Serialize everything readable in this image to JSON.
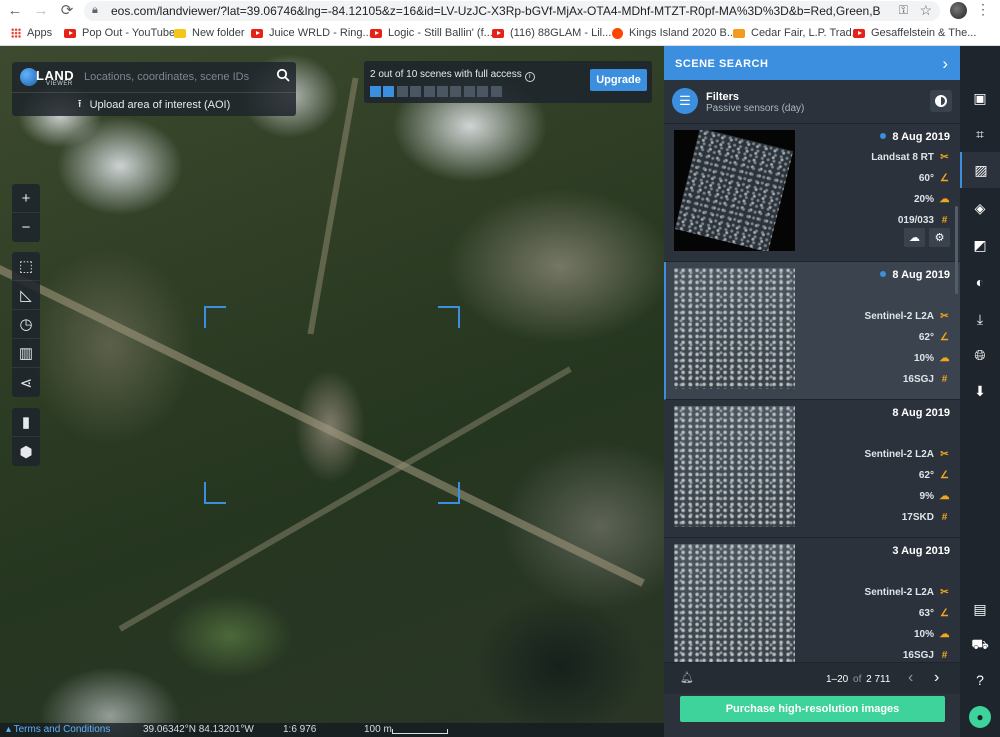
{
  "browser": {
    "url": "eos.com/landviewer/?lat=39.06746&lng=-84.12105&z=16&id=LV-UzJC-X3Rp-bGVf-MjAx-OTA4-MDhf-MTZT-R0pf-MA%3D%3D&b=Red,Green,Blue&anti",
    "bookmarks": [
      "Apps",
      "Pop Out - YouTube",
      "New folder",
      "Juice WRLD - Ring...",
      "Logic - Still Ballin' (f...",
      "(116) 88GLAM - Lil...",
      "Kings Island 2020 B...",
      "Cedar Fair, L.P. Trad...",
      "Gesaffelstein & The..."
    ]
  },
  "map": {
    "logo_text": "LAND",
    "logo_sub": "VIEWER",
    "search_placeholder": "Locations, coordinates, scene IDs",
    "upload_label": "Upload area of interest (AOI)",
    "access_text": "2 out of 10 scenes with full access",
    "access_used": 2,
    "access_total": 10,
    "upgrade_label": "Upgrade",
    "footer": {
      "terms": "Terms and Conditions",
      "coords": "39.06342°N 84.13201°W",
      "scale": "1:6 976",
      "scale_bar": "100 m"
    }
  },
  "panel": {
    "title": "SCENE SEARCH",
    "filters_label": "Filters",
    "filters_sub": "Passive sensors (day)",
    "scenes": [
      {
        "date": "8 Aug 2019",
        "satellite": "Landsat 8 RT",
        "angle": "60°",
        "clouds": "20%",
        "tile": "019/033"
      },
      {
        "date": "8 Aug 2019",
        "satellite": "Sentinel-2 L2A",
        "angle": "62°",
        "clouds": "10%",
        "tile": "16SGJ"
      },
      {
        "date": "8 Aug 2019",
        "satellite": "Sentinel-2 L2A",
        "angle": "62°",
        "clouds": "9%",
        "tile": "17SKD"
      },
      {
        "date": "3 Aug 2019",
        "satellite": "Sentinel-2 L2A",
        "angle": "63°",
        "clouds": "10%",
        "tile": "16SGJ"
      }
    ],
    "pager_range": "1–20",
    "pager_of": "of",
    "pager_total": "2 711",
    "purchase_label": "Purchase high-resolution images"
  },
  "colors": {
    "accent": "#3b8fde",
    "purchase": "#3dd39a",
    "meta_icon": "#f2a51f"
  }
}
